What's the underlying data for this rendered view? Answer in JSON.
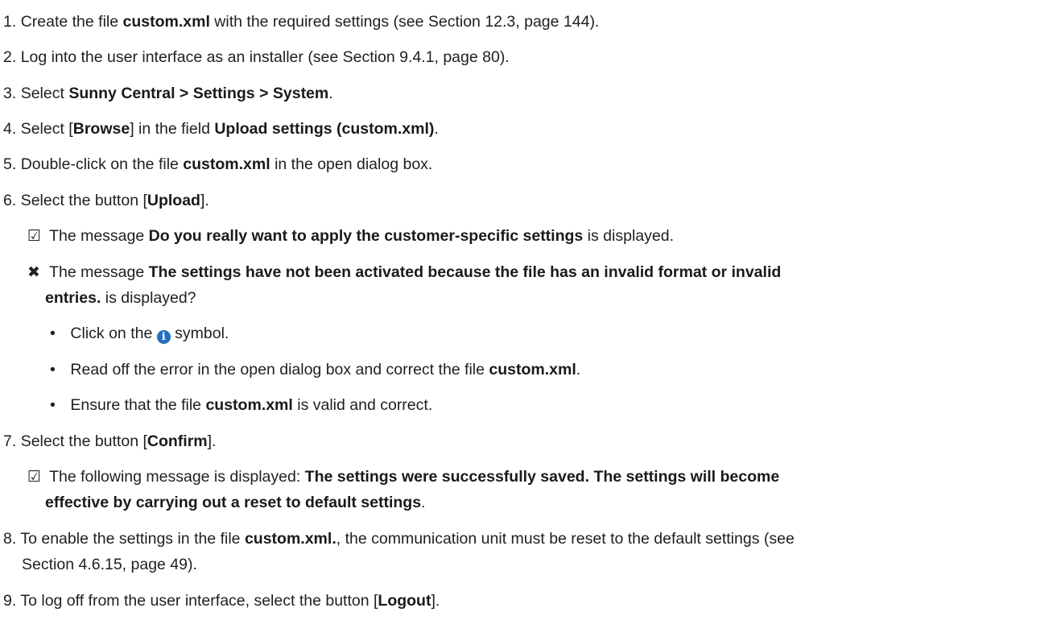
{
  "steps": [
    {
      "n": "1.",
      "a": "Create the file ",
      "b": "custom.xml",
      "c": " with the required settings (see Section 12.3, page 144)."
    },
    {
      "n": "2.",
      "a": "Log into the user interface as an installer (see Section 9.4.1, page 80)."
    },
    {
      "n": "3.",
      "a": "Select ",
      "b": "Sunny Central > Settings > System",
      "c": "."
    },
    {
      "n": "4.",
      "a": "Select [",
      "b": "Browse",
      "c": "] in the field ",
      "d": "Upload settings (custom.xml)",
      "e": "."
    },
    {
      "n": "5.",
      "a": "Double-click on the file ",
      "b": "custom.xml",
      "c": " in the open dialog box."
    },
    {
      "n": "6.",
      "a": "Select the button [",
      "b": "Upload",
      "c": "]."
    },
    {
      "n": "7.",
      "a": "Select the button [",
      "b": "Confirm",
      "c": "]."
    },
    {
      "n": "8.",
      "a": "To enable the settings in the file ",
      "b": "custom.xml.",
      "c": ", the communication unit must be reset to the default settings (see",
      "d": "Section 4.6.15, page 49)."
    },
    {
      "n": "9.",
      "a": "To log off from the user interface, select the button [",
      "b": "Logout",
      "c": "]."
    }
  ],
  "results": {
    "r1": {
      "sym": "☑",
      "a": "The message ",
      "b": "Do you really want to apply the customer-specific settings",
      "c": " is displayed."
    },
    "r2": {
      "sym": "✖",
      "a": "The message ",
      "b": "The settings have not been activated because the file has an invalid format or invalid",
      "b2": "entries.",
      "c": " is displayed?"
    },
    "r3": {
      "sym": "☑",
      "a": "The following message is displayed: ",
      "b": "The settings were successfully saved. The settings will become",
      "b2": "effective by carrying out a reset to default settings",
      "c": "."
    }
  },
  "bullets": [
    {
      "a": "Click on the ",
      "icon": "info-icon",
      "icon_glyph": "i",
      "c": " symbol."
    },
    {
      "a": "Read off the error in the open dialog box and correct the file ",
      "b": "custom.xml",
      "c": "."
    },
    {
      "a": "Ensure that the file ",
      "b": "custom.xml",
      "c": " is valid and correct."
    }
  ],
  "colors": {
    "info_icon": "#1f6fc9"
  }
}
